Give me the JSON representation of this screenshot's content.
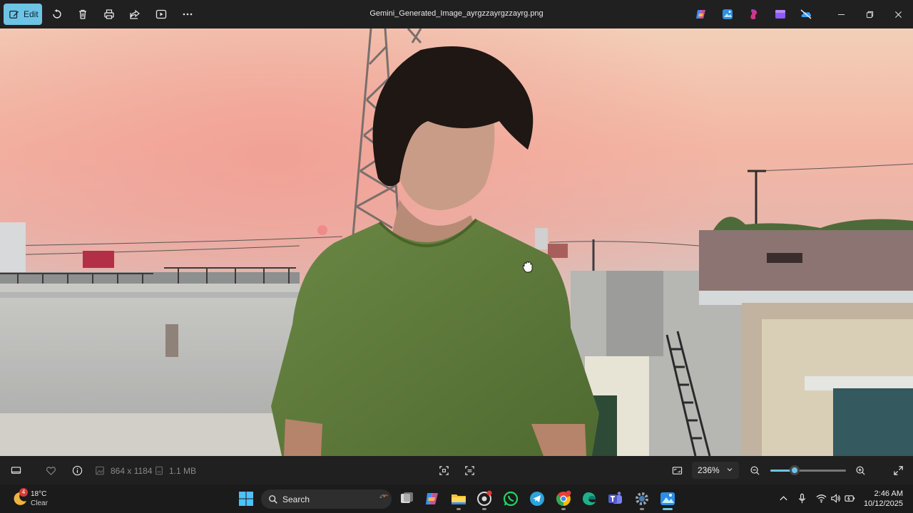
{
  "titlebar": {
    "edit_label": "Edit",
    "file_name": "Gemini_Generated_Image_ayrgzzayrgzzayrg.png",
    "toolbar_icons": [
      "rotate-icon",
      "delete-icon",
      "print-icon",
      "share-icon",
      "slideshow-icon",
      "more-icon"
    ],
    "app_icons": [
      "copilot-icon",
      "photos-editor-icon",
      "designer-icon",
      "clipchamp-icon",
      "onedrive-icon"
    ]
  },
  "photo": {
    "description_colors": {
      "sky_top": "#f3cfb8",
      "sky_glow": "#f1a99a",
      "shirt": "#5f7a3a",
      "hair": "#1e1714"
    }
  },
  "bottombar": {
    "dimensions": "864 x 1184",
    "file_size": "1.1 MB",
    "zoom_value": "236%",
    "zoom_fraction": 0.32
  },
  "taskbar": {
    "weather_temp": "18°C",
    "weather_condition": "Clear",
    "weather_badge": "4",
    "search_label": "Search",
    "time": "2:46 AM",
    "date": "10/12/2025",
    "apps": [
      "task-view-icon",
      "copilot-icon",
      "file-explorer-icon",
      "settings-app-icon",
      "whatsapp-icon",
      "telegram-icon",
      "chrome-icon",
      "edge-icon",
      "teams-icon",
      "settings-icon",
      "photos-icon"
    ]
  },
  "colors": {
    "accent": "#6cc4e6",
    "chrome": "#202020",
    "taskbar": "#1b1b1b"
  }
}
